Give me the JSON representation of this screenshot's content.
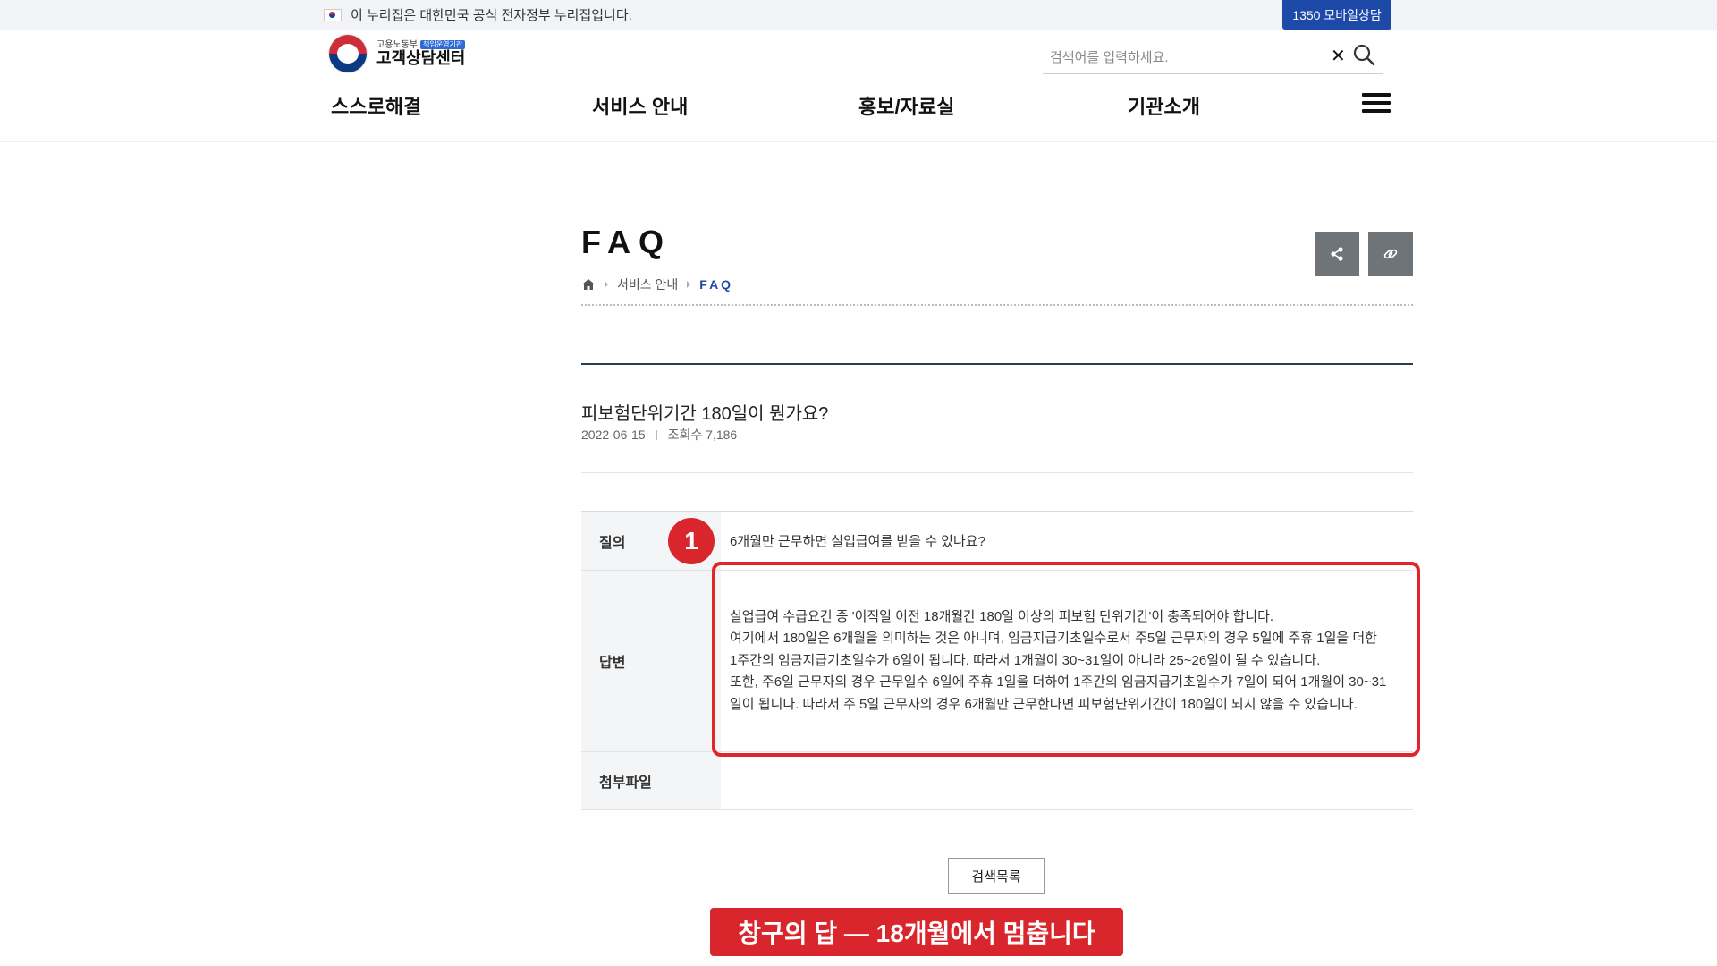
{
  "gov_banner": {
    "text": "이 누리집은 대한민국 공식 전자정부 누리집입니다.",
    "mobile_button": "1350 모바일상담"
  },
  "logo": {
    "ministry": "고용노동부",
    "badge": "책임운영기관",
    "name": "고객상담센터"
  },
  "search": {
    "placeholder": "검색어를 입력하세요.",
    "clear_icon": "close-icon",
    "search_icon": "search-icon"
  },
  "nav": {
    "items": [
      "스스로해결",
      "서비스 안내",
      "홍보/자료실",
      "기관소개"
    ],
    "menu_icon": "hamburger-icon"
  },
  "page": {
    "title": "FAQ",
    "breadcrumb": [
      "서비스 안내",
      "FAQ"
    ],
    "tools": [
      "share-icon",
      "link-icon"
    ]
  },
  "post": {
    "title": "피보험단위기간 180일이 뭔가요?",
    "date": "2022-06-15",
    "views": "조회수 7,186"
  },
  "table": {
    "question_label": "질의",
    "question": "6개월만 근무하면 실업급여를 받을 수 있나요?",
    "answer_label": "답변",
    "answer_lines": [
      "실업급여 수급요건 중 '이직일 이전 18개월간 180일 이상의 피보험 단위기간'이 충족되어야 합니다.",
      "여기에서 180일은 6개월을 의미하는 것은 아니며, 임금지급기초일수로서 주5일 근무자의 경우 5일에 주휴 1일을 더한 1주간의 임금지급기초일수가 6일이 됩니다. 따라서 1개월이 30~31일이 아니라 25~26일이 될 수 있습니다.",
      "또한, 주6일 근무자의 경우 근무일수 6일에 주휴 1일을 더하여 1주간의 임금지급기초일수가 7일이 되어 1개월이 30~31일이 됩니다. 따라서 주 5일 근무자의 경우 6개월만 근무한다면 피보험단위기간이 180일이 되지 않을 수 있습니다."
    ],
    "attachment_label": "첨부파일"
  },
  "annotation": {
    "badge": "1",
    "caption": "창구의 답 — 18개월에서 멈춥니다",
    "color": "#d9262c"
  },
  "list_button": "검색목록",
  "colors": {
    "brand_blue": "#1d4aa8",
    "dark_line": "#2b3a55",
    "tool_gray": "#6f7479"
  }
}
